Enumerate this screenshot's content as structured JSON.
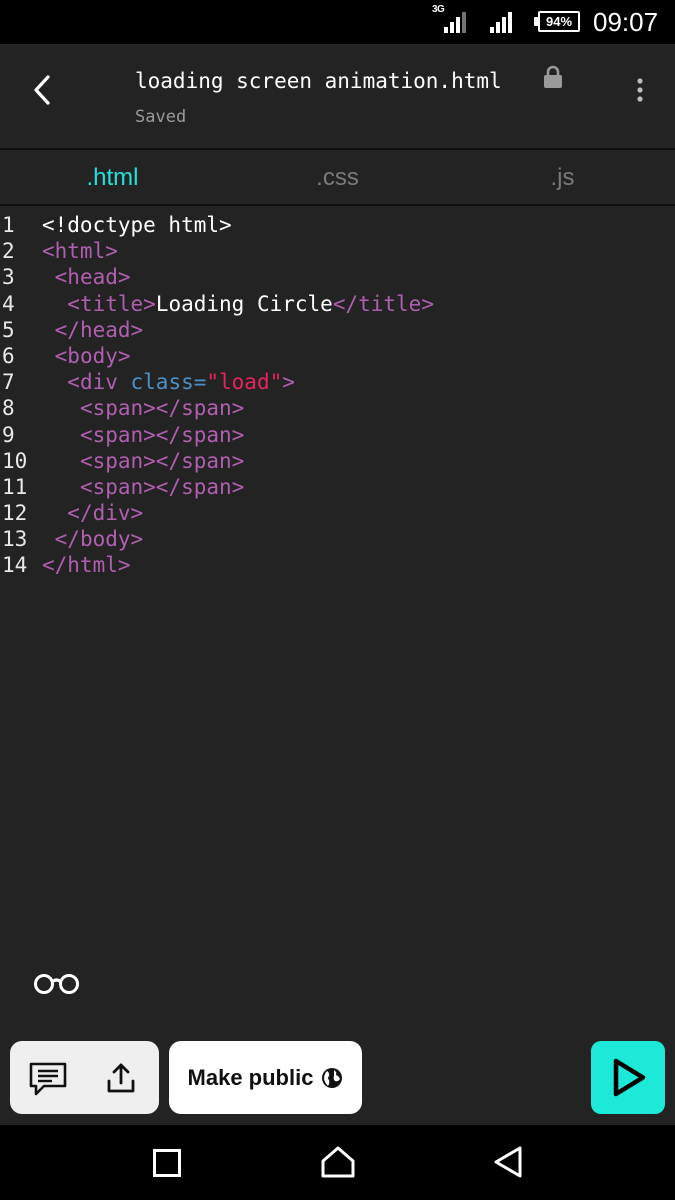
{
  "status_bar": {
    "network": "3G",
    "battery": "94%",
    "time": "09:07"
  },
  "header": {
    "title": "loading screen animation.html",
    "status": "Saved",
    "icons": [
      "back-arrow-icon",
      "lock-icon",
      "more-vert-icon"
    ]
  },
  "tabs": [
    {
      "label": ".html",
      "active": true
    },
    {
      "label": ".css",
      "active": false
    },
    {
      "label": ".js",
      "active": false
    }
  ],
  "code": {
    "lines": [
      {
        "n": "1",
        "ind": "",
        "toks": [
          [
            "w",
            "<!doctype html>"
          ]
        ]
      },
      {
        "n": "2",
        "ind": "",
        "toks": [
          [
            "t",
            "<html>"
          ]
        ]
      },
      {
        "n": "3",
        "ind": " ",
        "toks": [
          [
            "t",
            "<head>"
          ]
        ]
      },
      {
        "n": "4",
        "ind": "  ",
        "toks": [
          [
            "t",
            "<title>"
          ],
          [
            "w",
            "Loading Circle"
          ],
          [
            "t",
            "</title>"
          ]
        ]
      },
      {
        "n": "5",
        "ind": " ",
        "toks": [
          [
            "t",
            "</head>"
          ]
        ]
      },
      {
        "n": "6",
        "ind": " ",
        "toks": [
          [
            "t",
            "<body>"
          ]
        ]
      },
      {
        "n": "7",
        "ind": "  ",
        "toks": [
          [
            "t",
            "<div "
          ],
          [
            "a",
            "class="
          ],
          [
            "s",
            "\"load\""
          ],
          [
            "t",
            ">"
          ]
        ]
      },
      {
        "n": "8",
        "ind": "   ",
        "toks": [
          [
            "t",
            "<span></span>"
          ]
        ]
      },
      {
        "n": "9",
        "ind": "   ",
        "toks": [
          [
            "t",
            "<span></span>"
          ]
        ]
      },
      {
        "n": "10",
        "ind": "   ",
        "toks": [
          [
            "t",
            "<span></span>"
          ]
        ]
      },
      {
        "n": "11",
        "ind": "   ",
        "toks": [
          [
            "t",
            "<span></span>"
          ]
        ]
      },
      {
        "n": "12",
        "ind": "  ",
        "toks": [
          [
            "t",
            "</div>"
          ]
        ]
      },
      {
        "n": "13",
        "ind": " ",
        "toks": [
          [
            "t",
            "</body>"
          ]
        ]
      },
      {
        "n": "14",
        "ind": "",
        "toks": [
          [
            "t",
            "</html>"
          ]
        ]
      }
    ]
  },
  "toolbar": {
    "make_public_label": "Make public",
    "icons": [
      "glasses-icon",
      "comment-icon",
      "upload-icon",
      "globe-icon",
      "play-icon"
    ]
  },
  "colors": {
    "accent": "#1de9d8",
    "tag": "#b05fb0",
    "attribute": "#4e8fc4",
    "string": "#e8235a",
    "background": "#232323"
  }
}
